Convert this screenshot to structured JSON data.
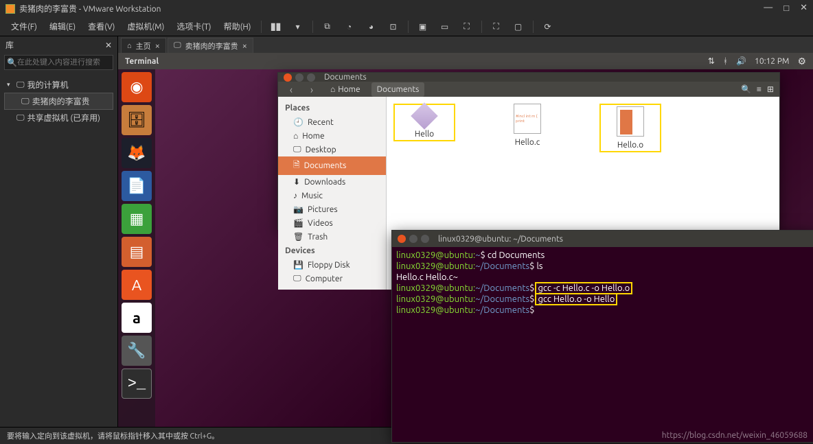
{
  "vmware": {
    "title": "卖猪肉的李富贵 - VMware Workstation",
    "menu": {
      "file": "文件(F)",
      "edit": "编辑(E)",
      "view": "查看(V)",
      "vm": "虚拟机(M)",
      "tabs": "选项卡(T)",
      "help": "帮助(H)"
    },
    "library_label": "库",
    "search_placeholder": "在此处键入内容进行搜索",
    "tree": {
      "my_computer": "我的计算机",
      "vm_name": "卖猪肉的李富贵",
      "shared": "共享虚拟机 (已弃用)"
    },
    "tabs": {
      "home": "主页",
      "vm": "卖猪肉的李富贵"
    },
    "statusbar": "要将输入定向到该虚拟机，请将鼠标指针移入其中或按 Ctrl+G。"
  },
  "ubuntu": {
    "topbar_title": "Terminal",
    "time": "10:12 PM"
  },
  "nautilus": {
    "title": "Documents",
    "crumb_home": "Home",
    "crumb_docs": "Documents",
    "section_places": "Places",
    "section_devices": "Devices",
    "places": {
      "recent": "Recent",
      "home": "Home",
      "desktop": "Desktop",
      "documents": "Documents",
      "downloads": "Downloads",
      "music": "Music",
      "pictures": "Pictures",
      "videos": "Videos",
      "trash": "Trash"
    },
    "devices": {
      "floppy": "Floppy Disk",
      "computer": "Computer"
    },
    "files": {
      "hello": "Hello",
      "helloc": "Hello.c",
      "helloo": "Hello.o",
      "c_preview": "#incl\nint m\n{\nprint"
    }
  },
  "terminal": {
    "title": "linux0329@ubuntu: ~/Documents",
    "user": "linux0329@ubuntu",
    "home_path": "~",
    "docs_path": "~/Documents",
    "dollar": "$",
    "cmd_cd": "cd Documents",
    "cmd_ls": "ls",
    "ls_output": "Hello.c  Hello.c~",
    "cmd_gcc1": "gcc -c Hello.c -o Hello.o",
    "cmd_gcc2": "gcc Hello.o -o Hello"
  },
  "watermark": "https://blog.csdn.net/weixin_46059688"
}
